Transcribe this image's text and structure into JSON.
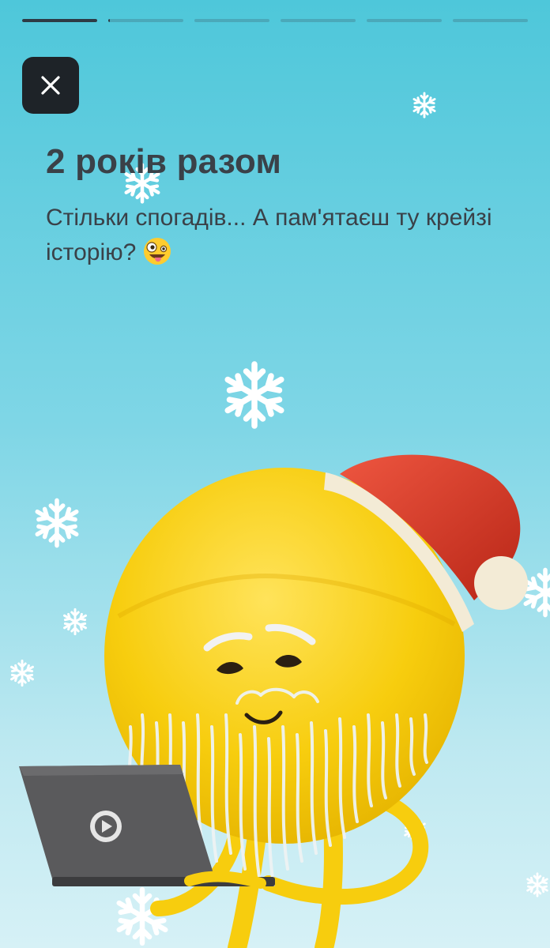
{
  "story": {
    "progress_total": 6,
    "progress_active_index": 1,
    "progress_active_fraction": 0.02,
    "title": "2 років разом",
    "subtitle": "Стільки спогадів... А пам'ятаєш ту крейзі історію?",
    "subtitle_emoji": "zany-face-emoji"
  },
  "colors": {
    "bg_top": "#4ec7da",
    "bg_bottom": "#d6f1f6",
    "text": "#3a4148",
    "close_bg": "#1e2328",
    "character": "#f7cd0e",
    "hat": "#d43a2a"
  },
  "icons": {
    "close": "close-icon",
    "play": "play-icon",
    "snowflake": "snowflake-icon"
  }
}
